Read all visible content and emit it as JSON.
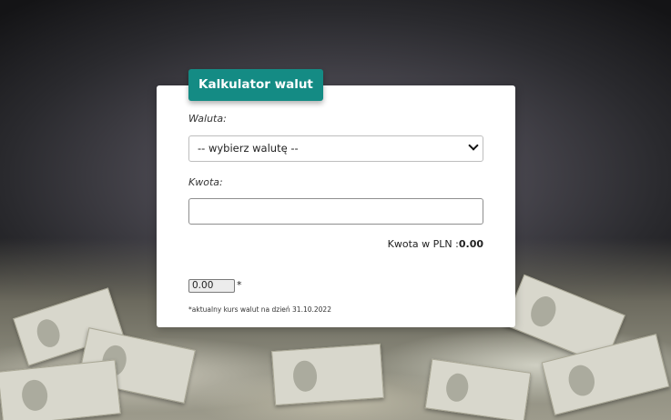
{
  "title": "Kalkulator walut",
  "currency": {
    "label": "Waluta:",
    "selected": "-- wybierz walutę --"
  },
  "amount": {
    "label": "Kwota:",
    "value": ""
  },
  "result": {
    "label": "Kwota w PLN :",
    "value": "0.00"
  },
  "rate": {
    "value": "0.00",
    "asterisk": "*"
  },
  "footnote": "*aktualny kurs walut na dzień 31.10.2022",
  "colors": {
    "accent": "#148b84",
    "card_bg": "#ffffff"
  }
}
